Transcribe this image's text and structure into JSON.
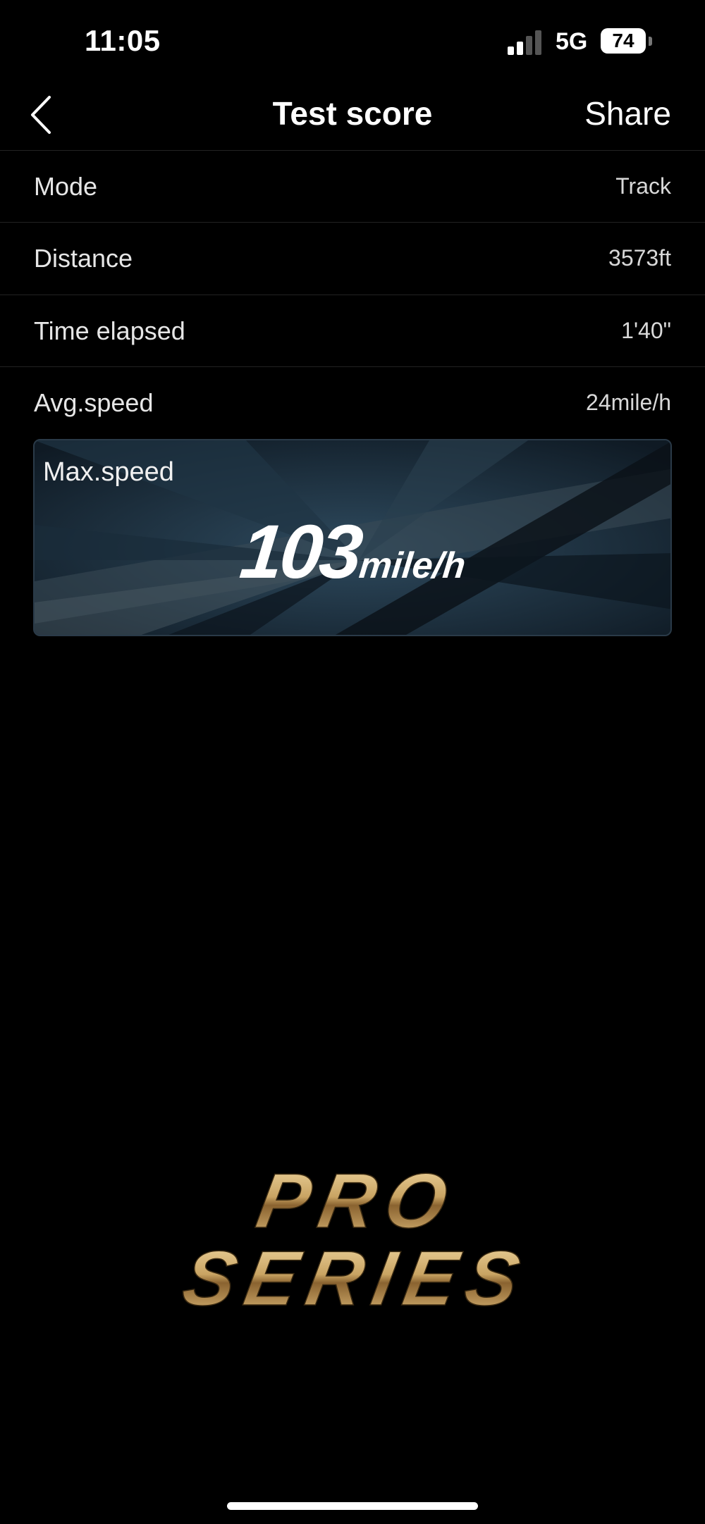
{
  "status_bar": {
    "time": "11:05",
    "network": "5G",
    "battery": "74",
    "signal_level": 0.5
  },
  "nav": {
    "title": "Test score",
    "share_label": "Share",
    "back_icon": "chevron-left-icon"
  },
  "rows": [
    {
      "label": "Mode",
      "value": "Track"
    },
    {
      "label": "Distance",
      "value": "3573ft"
    },
    {
      "label": "Time elapsed",
      "value": "1'40\""
    },
    {
      "label": "Avg.speed",
      "value": "24mile/h"
    }
  ],
  "max_speed": {
    "label": "Max.speed",
    "value": "103",
    "unit": "mile/h"
  },
  "logo": {
    "line1": "PRO",
    "line2": "SERIES"
  },
  "colors": {
    "background": "#000000",
    "card_bg": "#142230",
    "logo_gold": "#c9a463"
  }
}
